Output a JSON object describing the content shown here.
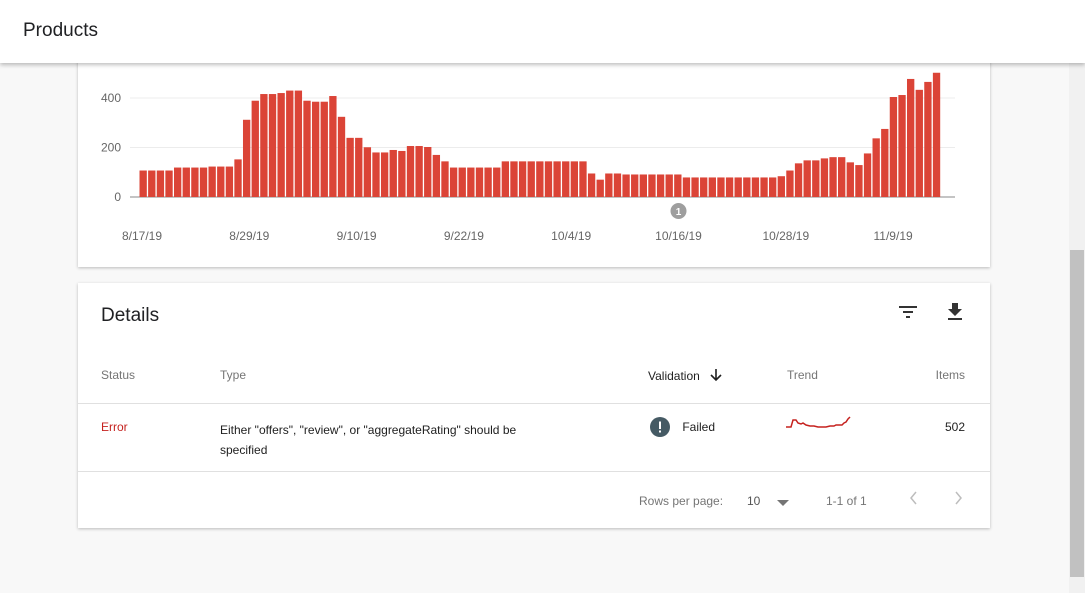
{
  "header": {
    "title": "Products"
  },
  "chart_data": {
    "type": "bar",
    "y_ticks": [
      "0",
      "200",
      "400"
    ],
    "ylim": [
      0,
      520
    ],
    "grid": true,
    "x_tick_labels": [
      "8/17/19",
      "8/29/19",
      "9/10/19",
      "9/22/19",
      "10/4/19",
      "10/16/19",
      "10/28/19",
      "11/9/19"
    ],
    "annotation": {
      "label": "1",
      "at": "10/16/19"
    },
    "color": "#db4437",
    "values": [
      107,
      107,
      107,
      107,
      119,
      119,
      119,
      119,
      123,
      123,
      123,
      152,
      312,
      389,
      416,
      416,
      420,
      430,
      430,
      389,
      385,
      385,
      408,
      324,
      239,
      239,
      201,
      180,
      180,
      190,
      186,
      206,
      206,
      202,
      170,
      144,
      119,
      119,
      119,
      119,
      119,
      119,
      144,
      144,
      144,
      144,
      144,
      144,
      144,
      144,
      144,
      144,
      95,
      70,
      95,
      95,
      91,
      91,
      91,
      91,
      91,
      91,
      91,
      79,
      79,
      79,
      79,
      79,
      79,
      79,
      79,
      79,
      79,
      79,
      84,
      107,
      136,
      148,
      148,
      156,
      161,
      161,
      140,
      129,
      176,
      237,
      275,
      404,
      412,
      477,
      433,
      465,
      502
    ]
  },
  "details": {
    "title": "Details",
    "filter_icon": "filter-icon",
    "download_icon": "download-icon",
    "columns": {
      "status": "Status",
      "type": "Type",
      "validation": "Validation",
      "trend": "Trend",
      "items": "Items"
    },
    "rows": [
      {
        "status": "Error",
        "type_line1": "Either \"offers\", \"review\", or \"aggregateRating\" should be",
        "type_line2": "specified",
        "validation": "Failed",
        "items": "502"
      }
    ],
    "pagination": {
      "rows_per_page_label": "Rows per page:",
      "rows_per_page": "10",
      "range": "1-1 of 1"
    },
    "colors": {
      "error": "#c5221f",
      "trend": "#c5221f",
      "failed_icon": "#455a64"
    }
  }
}
